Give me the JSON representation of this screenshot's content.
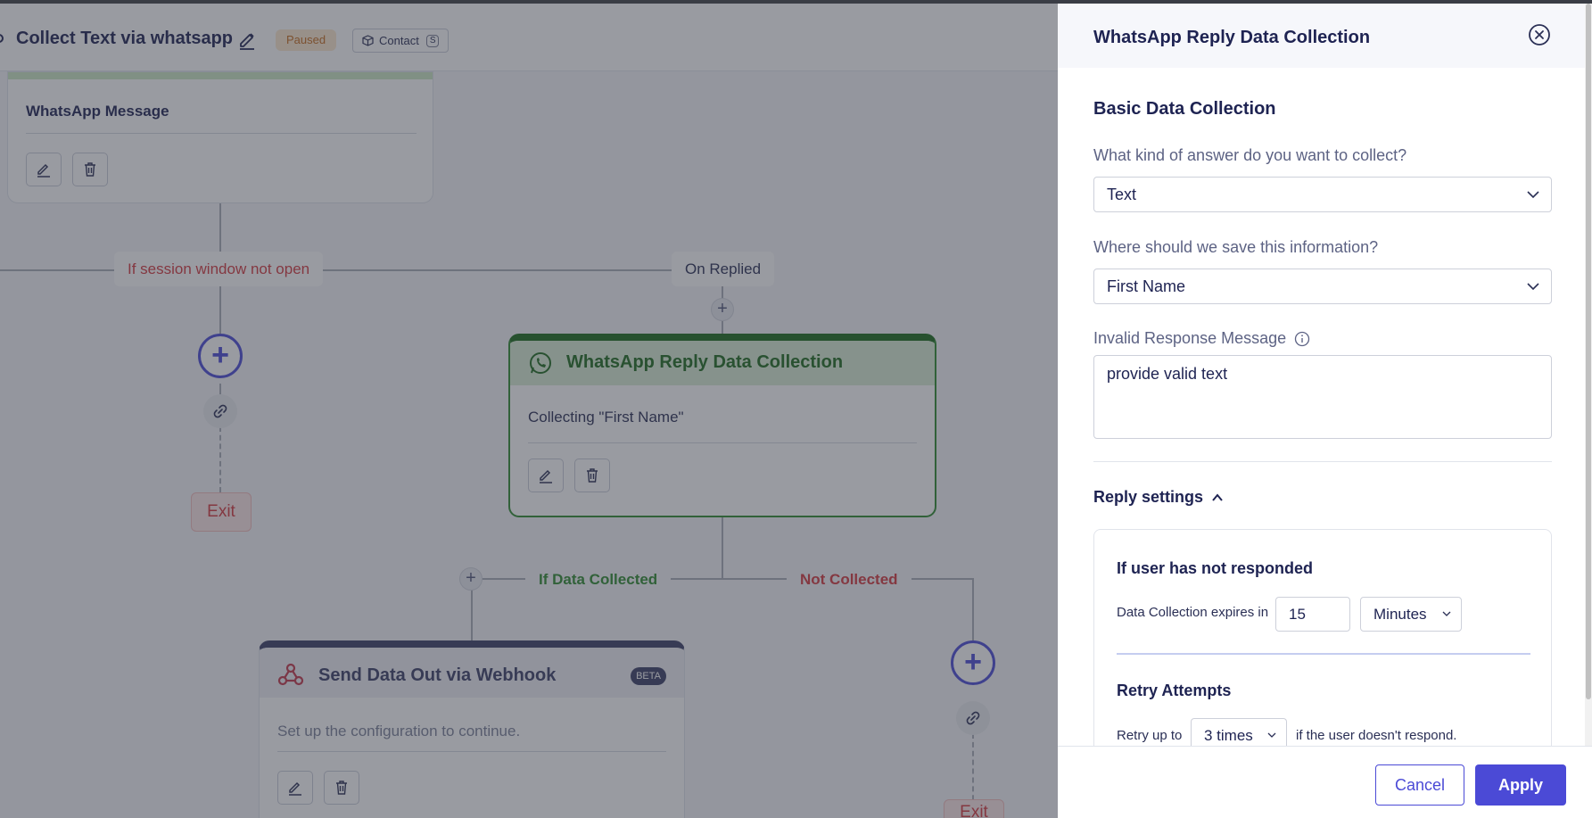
{
  "flow": {
    "title": "Collect Text via whatsapp",
    "status": "Paused",
    "contact_label": "Contact",
    "contact_key": "S"
  },
  "canvas": {
    "wa_message_node": {
      "name": "WhatsApp Message"
    },
    "branches": {
      "session_closed": "If session window not open",
      "on_replied": "On Replied",
      "if_collected": "If Data Collected",
      "not_collected": "Not Collected"
    },
    "exit_label": "Exit",
    "exit_label_2": "Exit",
    "wa_reply_node": {
      "title": "WhatsApp Reply Data Collection",
      "subtitle": "Collecting \"First Name\""
    },
    "webhook_node": {
      "title": "Send Data Out via Webhook",
      "badge": "BETA",
      "description": "Set up the configuration to continue."
    }
  },
  "panel": {
    "title": "WhatsApp Reply Data Collection",
    "section_title": "Basic Data Collection",
    "answer_type_label": "What kind of answer do you want to collect?",
    "answer_type_value": "Text",
    "save_field_label": "Where should we save this information?",
    "save_field_value": "First Name",
    "invalid_msg_label": "Invalid Response Message",
    "invalid_msg_value": "provide valid text",
    "reply_settings_label": "Reply settings",
    "no_response_heading": "If user has not responded",
    "expires_label": "Data Collection expires in",
    "expires_value": "15",
    "expires_unit": "Minutes",
    "retry_heading": "Retry Attempts",
    "retry_prefix": "Retry up to",
    "retry_value": "3 times",
    "retry_suffix": "if the user doesn't respond.",
    "cancel_label": "Cancel",
    "apply_label": "Apply"
  },
  "colors": {
    "accent": "#4b4ad6",
    "paused_bg": "#fde8cf",
    "paused_text": "#c46b1d",
    "green": "#1e6b1e",
    "red": "#d4383f"
  },
  "icons": [
    "edit-icon",
    "trash-icon",
    "contact-icon",
    "link-icon",
    "whatsapp-icon",
    "webhook-icon",
    "close-icon",
    "chevron-down-icon",
    "chevron-up-icon",
    "info-icon",
    "plus-icon"
  ]
}
